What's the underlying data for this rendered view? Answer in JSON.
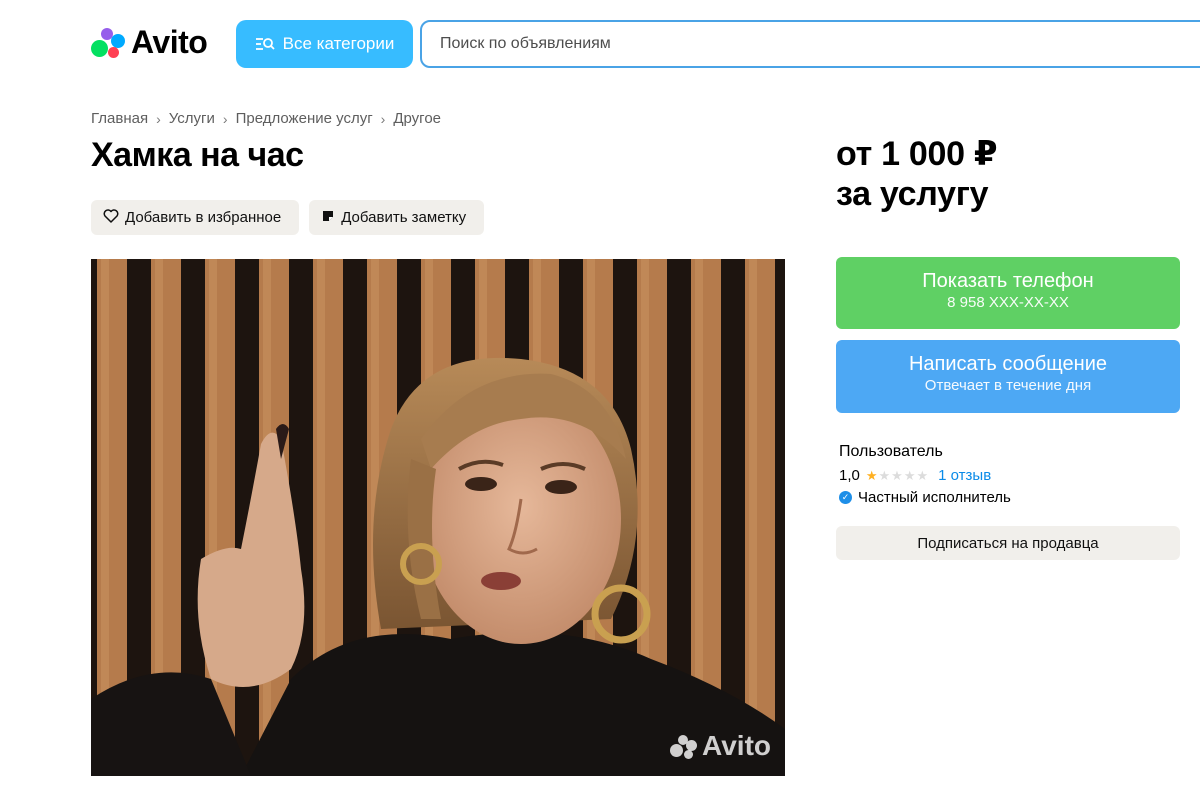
{
  "header": {
    "logo_text": "Avito",
    "categories_label": "Все категории",
    "search_placeholder": "Поиск по объявлениям"
  },
  "breadcrumb": [
    "Главная",
    "Услуги",
    "Предложение услуг",
    "Другое"
  ],
  "listing": {
    "title": "Хамка на час",
    "add_favorite_label": "Добавить в избранное",
    "add_note_label": "Добавить заметку",
    "photo_watermark": "Avito"
  },
  "sidebar": {
    "price_line1": "от 1 000 ₽",
    "price_line2": "за услугу",
    "show_phone_label": "Показать телефон",
    "phone_masked": "8 958 XXX-XX-XX",
    "write_message_label": "Написать сообщение",
    "response_time": "Отвечает в течение дня",
    "seller_name": "Пользователь",
    "rating": "1,0",
    "rating_stars": 1,
    "reviews_label": "1 отзыв",
    "seller_type": "Частный исполнитель",
    "subscribe_label": "Подписаться на продавца"
  },
  "colors": {
    "accent_blue": "#00aaff",
    "phone_green": "#5fd064",
    "message_blue": "#4da8f4",
    "link_blue": "#0a8be8",
    "star": "#ffb021"
  }
}
